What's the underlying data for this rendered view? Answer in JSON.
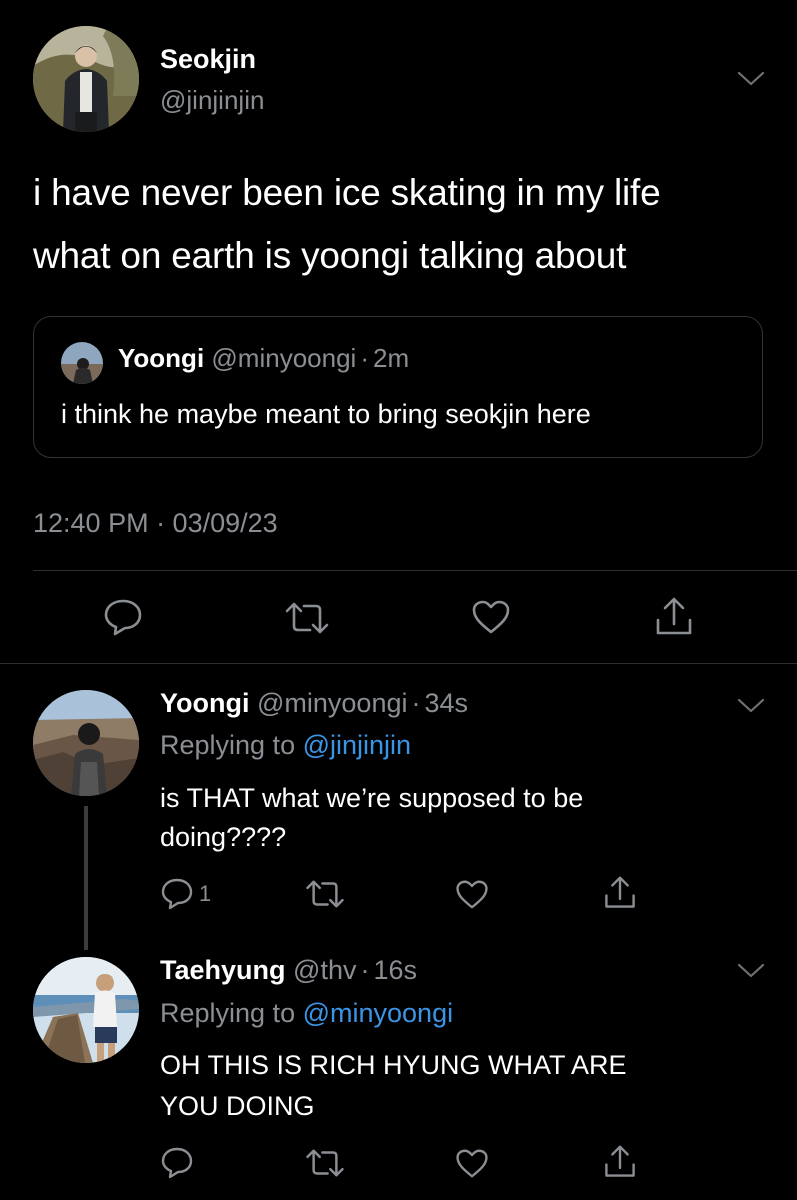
{
  "main_tweet": {
    "author_name": "Seokjin",
    "author_handle": "@jinjinjin",
    "text_line1": "i have never been ice skating in my life",
    "text_line2": "what on earth is yoongi talking about",
    "timestamp": "12:40 PM · 03/09/23"
  },
  "quoted_tweet": {
    "author_name": "Yoongi",
    "author_handle": "@minyoongi",
    "separator": "·",
    "time": "2m",
    "text": "i think he maybe meant to bring seokjin here"
  },
  "replies": [
    {
      "author_name": "Yoongi",
      "author_handle": "@minyoongi",
      "separator": "·",
      "time": "34s",
      "replying_label": "Replying to",
      "replying_handle": "@jinjinjin",
      "text_line1": "is THAT what we’re supposed to be",
      "text_line2": "doing????",
      "reply_count": "1"
    },
    {
      "author_name": "Taehyung",
      "author_handle": "@thv",
      "separator": "·",
      "time": "16s",
      "replying_label": "Replying to",
      "replying_handle": "@minyoongi",
      "text_line1": "OH THIS IS RICH HYUNG WHAT ARE",
      "text_line2": "YOU DOING"
    }
  ],
  "icons": [
    "reply-icon",
    "retweet-icon",
    "like-icon",
    "share-icon",
    "chevron-down-icon"
  ],
  "colors": {
    "background": "#000000",
    "secondary_text": "#8b8f94",
    "link": "#3b95e6",
    "divider": "#2b2d30"
  }
}
